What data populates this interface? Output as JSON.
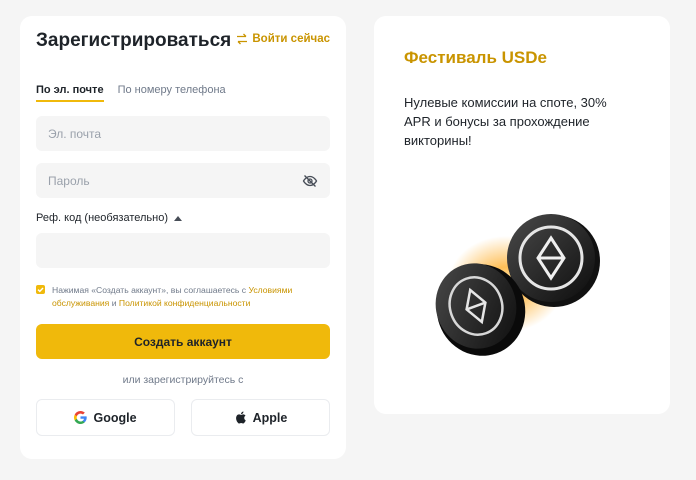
{
  "form": {
    "title": "Зарегистрироваться",
    "login_link": "Войти сейчас",
    "tabs": [
      {
        "label": "По эл. почте",
        "active": true
      },
      {
        "label": "По номеру телефона",
        "active": false
      }
    ],
    "email_placeholder": "Эл. почта",
    "password_placeholder": "Пароль",
    "ref_label": "Реф. код (необязательно)",
    "ref_value": "",
    "agree_prefix": "Нажимая «Создать аккаунт», вы соглашаетесь с",
    "terms_link": "Условиями обслуживания",
    "agree_and": "и",
    "privacy_link": "Политикой конфиденциальности",
    "submit_label": "Создать аккаунт",
    "or_text": "или зарегистрируйтесь с",
    "google_label": "Google",
    "apple_label": "Apple"
  },
  "promo": {
    "title": "Фестиваль USDe",
    "description": "Нулевые комиссии на споте, 30% APR и бонусы за прохождение викторины!"
  },
  "colors": {
    "accent": "#f0b90b",
    "accent_text": "#c99400",
    "text": "#1e2329",
    "muted": "#707a8a",
    "field_bg": "#f5f5f5"
  },
  "icons": [
    "swap-icon",
    "eye-off-icon",
    "caret-up-icon",
    "checkbox-checked-icon",
    "google-icon",
    "apple-icon",
    "usde-coins-image"
  ]
}
